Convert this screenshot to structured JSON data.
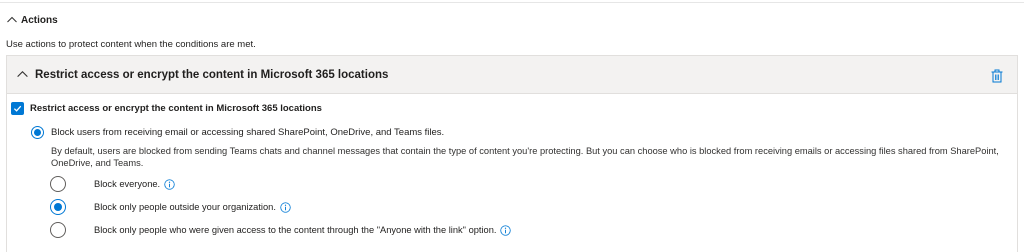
{
  "section": {
    "title": "Actions",
    "description": "Use actions to protect content when the conditions are met."
  },
  "card": {
    "title": "Restrict access or encrypt the content in Microsoft 365 locations",
    "checkbox_label": "Restrict access or encrypt the content in Microsoft 365 locations",
    "checkbox_checked": true,
    "main_option": {
      "label": "Block users from receiving email or accessing shared SharePoint, OneDrive, and Teams files.",
      "selected": true,
      "description": "By default, users are blocked from sending Teams chats and channel messages that contain the type of content you're protecting. But you can choose who is blocked from receiving emails or accessing files shared from SharePoint, OneDrive, and Teams."
    },
    "sub_options": [
      {
        "label": "Block everyone.",
        "selected": false
      },
      {
        "label": "Block only people outside your organization.",
        "selected": true
      },
      {
        "label": "Block only people who were given access to the content through the \"Anyone with the link\" option.",
        "selected": false
      }
    ]
  },
  "icons": {
    "section_toggle": "chevron-up-icon",
    "card_toggle": "chevron-up-icon",
    "delete": "trash-icon",
    "info": "info-icon",
    "check": "checkmark-icon"
  },
  "colors": {
    "accent": "#0078d4",
    "card_header_bg": "#f3f2f1",
    "border": "#e1dfdd"
  }
}
